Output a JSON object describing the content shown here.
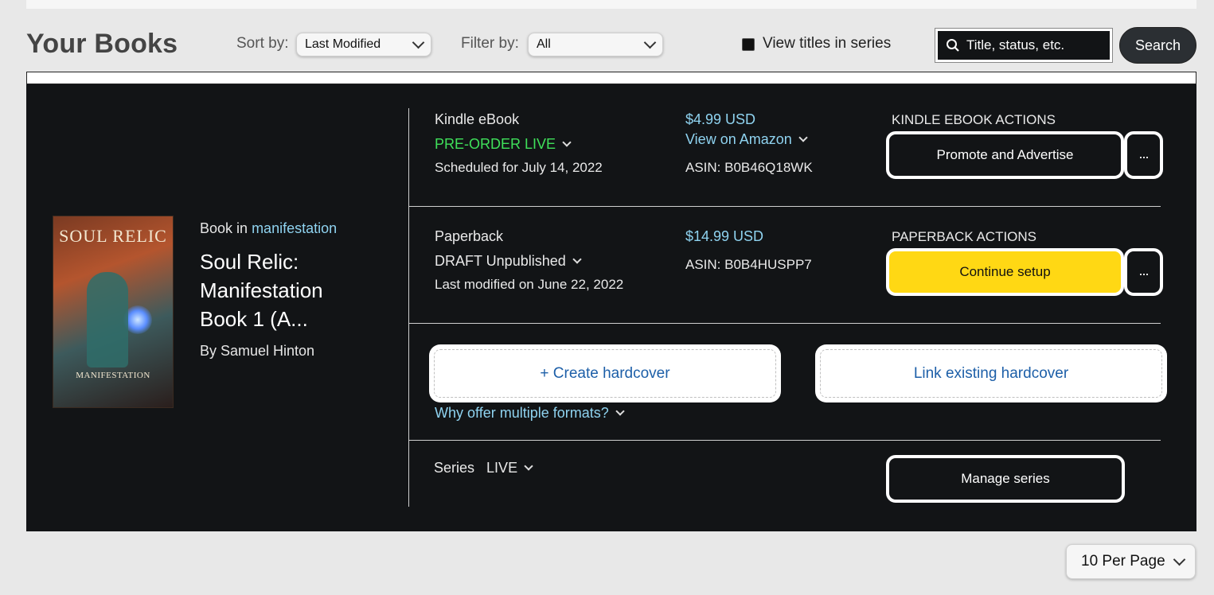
{
  "header": {
    "title": "Your Books",
    "sort_label": "Sort by:",
    "sort_value": "Last Modified",
    "filter_label": "Filter by:",
    "filter_value": "All",
    "view_series_label": "View titles in series",
    "search_placeholder": "Title, status, etc.",
    "search_button": "Search"
  },
  "book": {
    "cover_title": "SOUL RELIC",
    "cover_subtitle": "MANIFESTATION",
    "series_prefix": "Book in",
    "series_name": "manifestation",
    "title": "Soul Relic: Manifestation Book 1 (A...",
    "author": "By Samuel Hinton"
  },
  "formats": {
    "kindle": {
      "type": "Kindle eBook",
      "status": "PRE-ORDER LIVE",
      "date": "Scheduled for July 14, 2022",
      "price": "$4.99 USD",
      "view_link": "View on Amazon",
      "asin": "ASIN: B0B46Q18WK",
      "actions_label": "KINDLE EBOOK ACTIONS",
      "primary_action": "Promote and Advertise",
      "more": "..."
    },
    "paperback": {
      "type": "Paperback",
      "status": "DRAFT Unpublished",
      "date": "Last modified on June 22, 2022",
      "price": "$14.99 USD",
      "asin": "ASIN: B0B4HUSPP7",
      "actions_label": "PAPERBACK ACTIONS",
      "primary_action": "Continue setup",
      "more": "..."
    },
    "hardcover": {
      "create": "+ Create hardcover",
      "link": "Link existing hardcover",
      "why": "Why offer multiple formats?"
    },
    "series": {
      "label": "Series",
      "status": "LIVE",
      "manage": "Manage series"
    }
  },
  "pagination": {
    "per_page": "10 Per Page"
  },
  "colors": {
    "panel": "#121416",
    "link": "#8fd3f0",
    "live_green": "#3fe05a",
    "primary_yellow": "#ffd814",
    "hardcover_link": "#1d5fa8"
  }
}
